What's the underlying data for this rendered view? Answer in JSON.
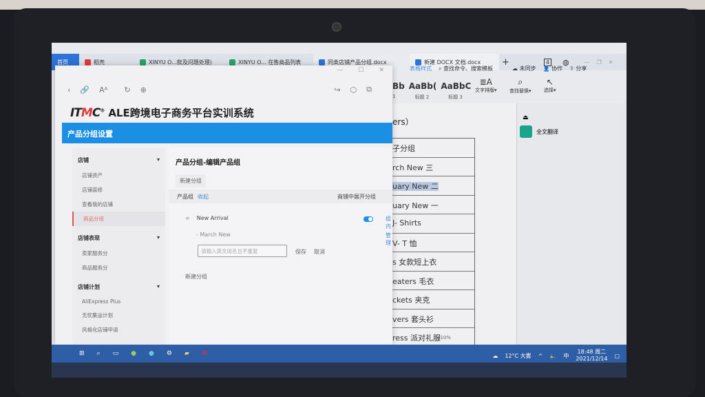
{
  "tabs": [
    {
      "label": "首页"
    },
    {
      "label": "稻壳"
    },
    {
      "label": "XINYU O...款及问题处理)"
    },
    {
      "label": "XINYU O... 在售商品列表"
    },
    {
      "label": "同类店铺产品分组.docx"
    },
    {
      "label": "新建 DOCX 文档.docx"
    }
  ],
  "tab_count": "4",
  "app": {
    "brand": "ITMC",
    "title": "ALE跨境电子商务平台实训系统",
    "section": "产品分组设置"
  },
  "sidebar": [
    {
      "title": "店铺",
      "items": [
        "店铺资产",
        "店铺装修",
        "查看我的店铺",
        "商品分组"
      ],
      "active": 3
    },
    {
      "title": "店铺表现",
      "items": [
        "卖家服务分",
        "商品服务分"
      ]
    },
    {
      "title": "店铺计划",
      "items": [
        "AliExpress Plus",
        "无忧集运计划",
        "风格化店铺申请"
      ]
    }
  ],
  "main": {
    "heading": "产品分组-编辑产品组",
    "new_group": "新建分组",
    "group_label": "产品组",
    "collapse": "收起",
    "expand_in_store": "商铺中展开分组",
    "group_name": "New Arrival",
    "group_action": "组内",
    "subgroup_name": "March New",
    "manage": "管理",
    "input_placeholder": "请输入英文组名且不重复",
    "save": "保存",
    "cancel": "取消",
    "new_group_bottom": "新建分组",
    "toggle_on": true
  },
  "word": {
    "table_style": "表格样式",
    "search": "查找命令、搜索模板",
    "sync": "未同步",
    "collab": "协作",
    "share": "分享",
    "styles": [
      "Bb",
      "AaBb(",
      "AaBbC"
    ],
    "style_labels": [
      "1",
      "标题 2",
      "标题 3"
    ],
    "text_layout": "文字排版",
    "find_replace": "查找替换",
    "select": "选择",
    "heading_frag": "ers）",
    "table_rows": [
      "子分组",
      "rch New 三",
      "uary New 二",
      "uary New 一",
      "J- Shirts",
      "V- T 恤",
      "s 女款短上衣",
      "eaters 毛衣",
      "ckets 夹克",
      "vers 套头衫",
      "ress 派对礼服"
    ],
    "highlight_row": 2,
    "translate": "全文翻译",
    "zoom": "110%"
  },
  "taskbar": {
    "weather": "12°C 大雾",
    "ime": "中",
    "time": "18:48 周二",
    "date": "2021/12/14"
  }
}
